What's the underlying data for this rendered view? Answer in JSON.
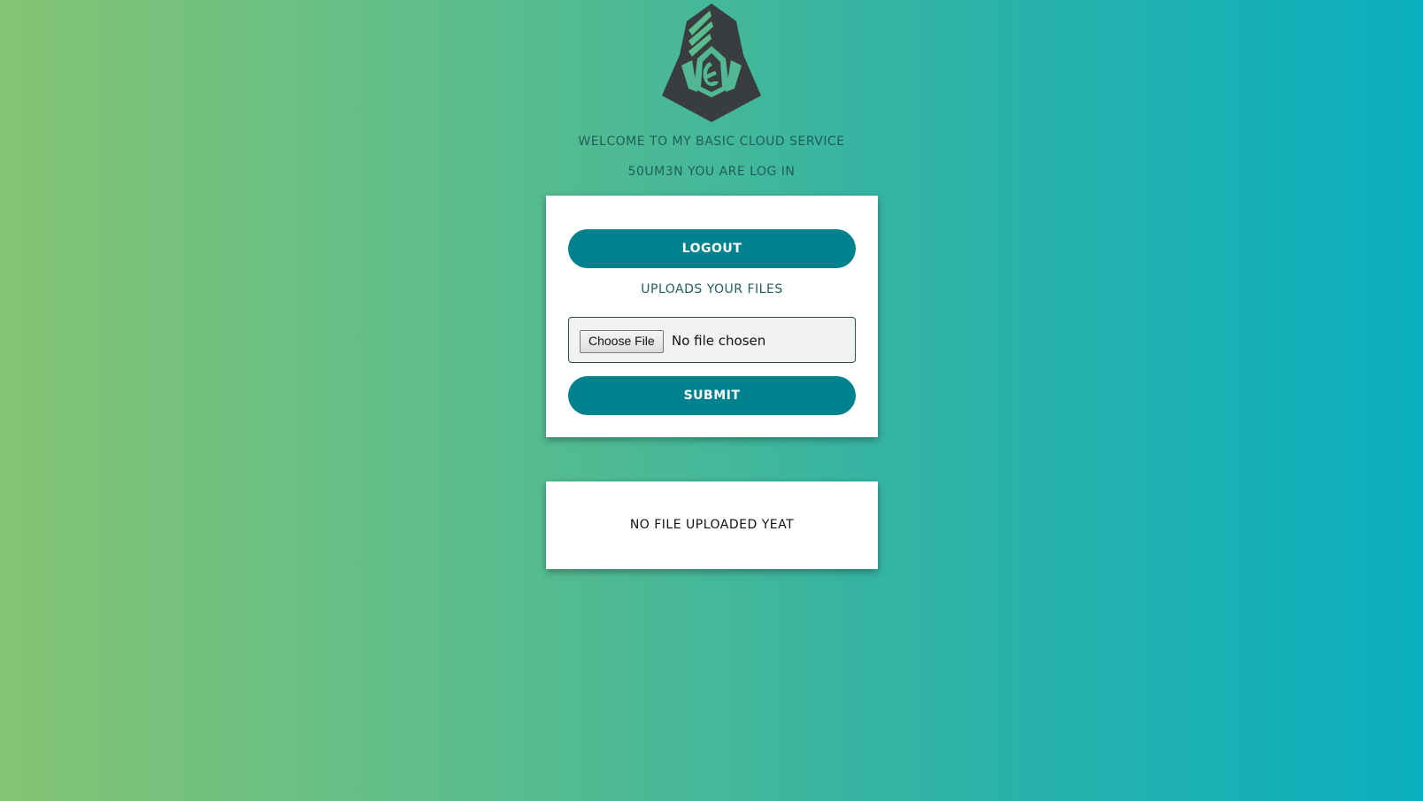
{
  "logo": {
    "icon": "hooded-figure-icon",
    "color": "#3a3d3f"
  },
  "header": {
    "welcome_text": "WELCOME TO MY BASIC CLOUD SERVICE",
    "status_text": "50UM3N YOU ARE LOG IN"
  },
  "upload_card": {
    "logout_label": "LOGOUT",
    "upload_title": "UPLOADS YOUR FILES",
    "choose_file_label": "Choose File",
    "file_status": "No file chosen",
    "submit_label": "SUBMIT"
  },
  "files_card": {
    "empty_message": "NO FILE UPLOADED YEAT"
  },
  "colors": {
    "button": "#00818e",
    "gradient_start": "#84c474",
    "gradient_end": "#0bafbf",
    "heading_text": "#1f5e5a"
  }
}
